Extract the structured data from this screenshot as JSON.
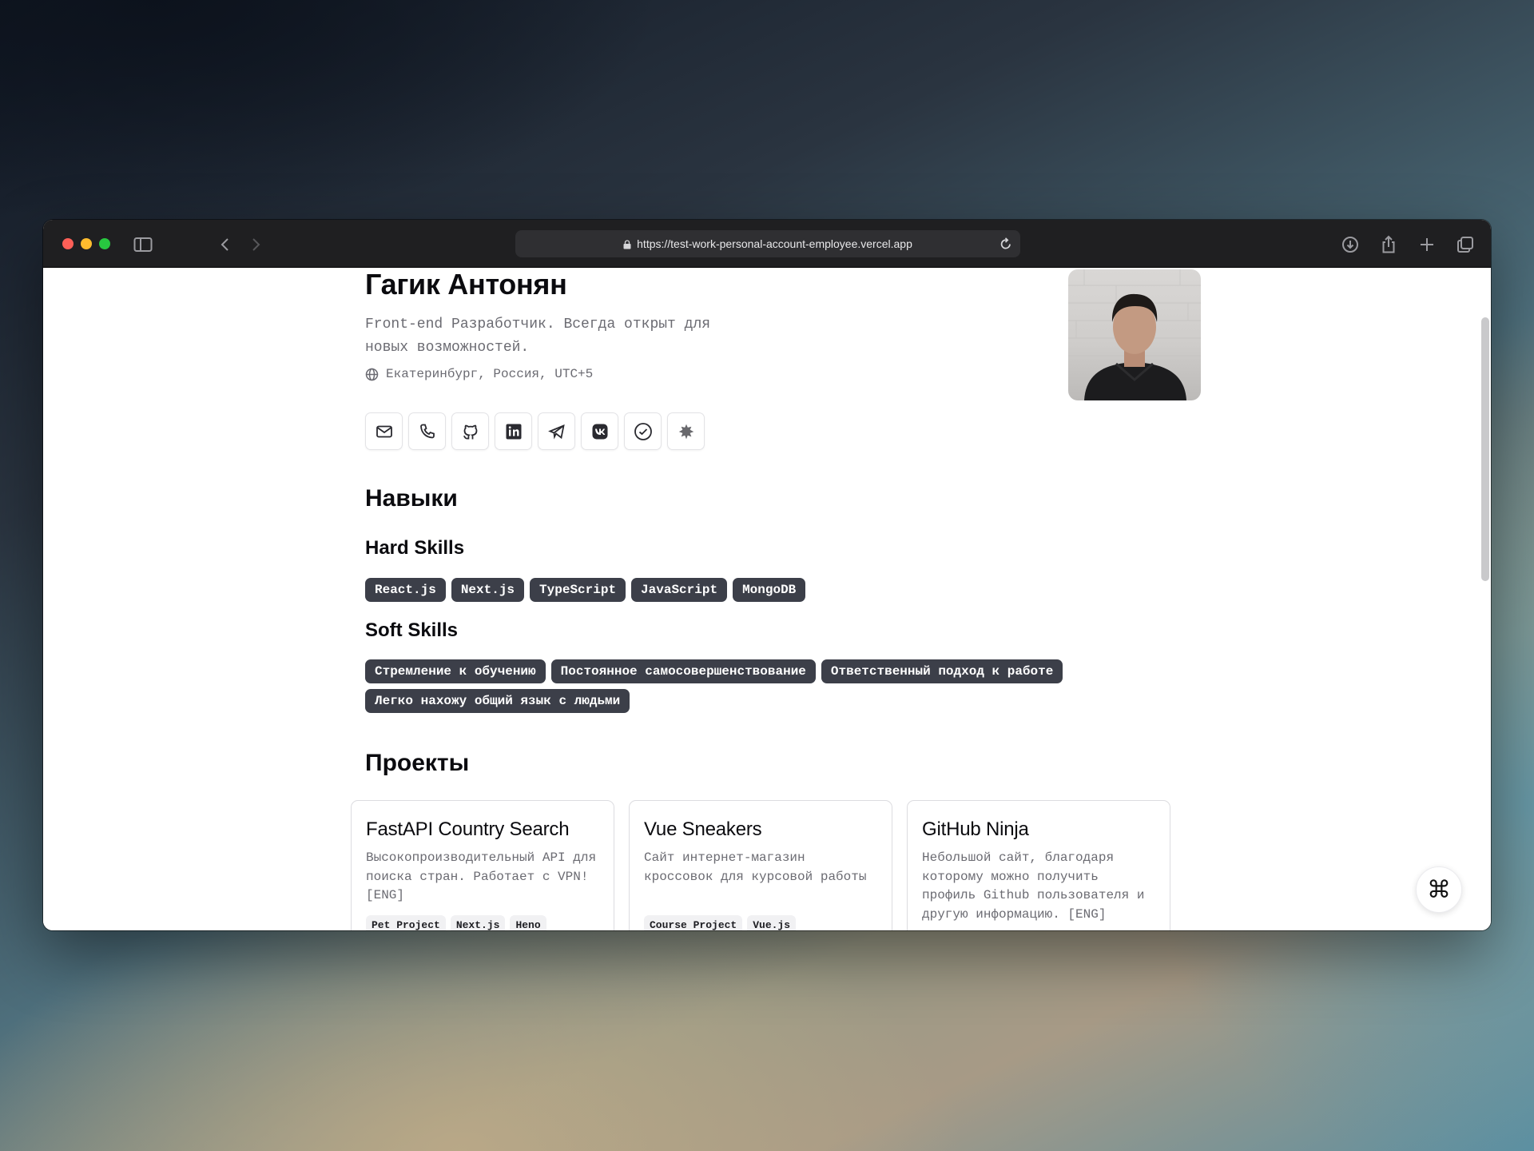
{
  "browser": {
    "url": "https://test-work-personal-account-employee.vercel.app"
  },
  "profile": {
    "name": "Гагик Антонян",
    "tagline": "Front-end Разработчик. Всегда открыт для новых возможностей.",
    "location": "Екатеринбург, Россия, UTC+5",
    "socials": [
      {
        "icon": "mail-icon"
      },
      {
        "icon": "phone-icon"
      },
      {
        "icon": "github-icon"
      },
      {
        "icon": "linkedin-icon"
      },
      {
        "icon": "telegram-icon"
      },
      {
        "icon": "vk-icon"
      },
      {
        "icon": "hh-icon"
      },
      {
        "icon": "habr-icon"
      }
    ]
  },
  "skills": {
    "heading": "Навыки",
    "hard_heading": "Hard Skills",
    "hard": [
      "React.js",
      "Next.js",
      "TypeScript",
      "JavaScript",
      "MongoDB"
    ],
    "soft_heading": "Soft Skills",
    "soft": [
      "Стремление к обучению",
      "Постоянное самосовершенствование",
      "Ответственный подход к работе",
      "Легко нахожу общий язык с людьми"
    ]
  },
  "projects": {
    "heading": "Проекты",
    "items": [
      {
        "title": "FastAPI Country Search",
        "description": "Высокопроизводительный API для поиска стран. Работает с VPN! [ENG]",
        "tags": [
          "Pet Project",
          "Next.js",
          "Heno"
        ]
      },
      {
        "title": "Vue Sneakers",
        "description": "Сайт интернет-магазин кроссовок для курсовой работы",
        "tags": [
          "Course Project",
          "Vue.js"
        ]
      },
      {
        "title": "GitHub Ninja",
        "description": "Небольшой сайт, благодаря которому можно получить профиль Github пользователя и другую информацию. [ENG]",
        "tags": []
      }
    ]
  },
  "command_button": {
    "label": "⌘",
    "icon": "command-icon"
  }
}
